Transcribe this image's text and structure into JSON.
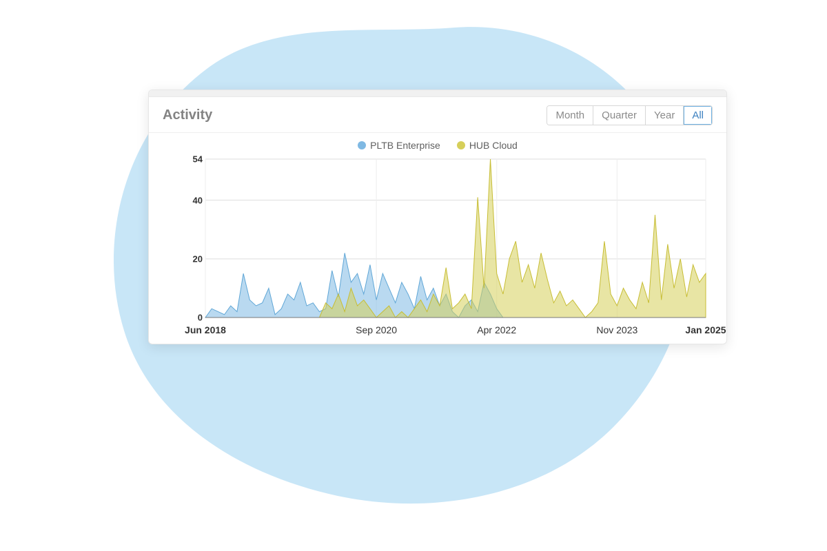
{
  "card": {
    "title": "Activity",
    "ranges": [
      "Month",
      "Quarter",
      "Year",
      "All"
    ],
    "active_range": "All"
  },
  "legend": {
    "series_a": {
      "label": "PLTB Enterprise",
      "color": "#7fb9e3"
    },
    "series_b": {
      "label": "HUB Cloud",
      "color": "#d6cf5a"
    }
  },
  "chart_data": {
    "type": "area",
    "title": "Activity",
    "xlabel": "",
    "ylabel": "",
    "ylim": [
      0,
      54
    ],
    "y_ticks": [
      0,
      20,
      40,
      54
    ],
    "x_ticks": [
      {
        "label": "Jun 2018",
        "pos": 0,
        "bold": true
      },
      {
        "label": "Sep 2020",
        "pos": 27,
        "bold": false
      },
      {
        "label": "Apr 2022",
        "pos": 46,
        "bold": false
      },
      {
        "label": "Nov 2023",
        "pos": 65,
        "bold": false
      },
      {
        "label": "Jan 2025",
        "pos": 79,
        "bold": true
      }
    ],
    "x_range": [
      0,
      79
    ],
    "series": [
      {
        "name": "PLTB Enterprise",
        "color_fill": "rgba(127,185,227,0.55)",
        "color_stroke": "#5fa6d6",
        "values": [
          0,
          3,
          2,
          1,
          4,
          2,
          15,
          6,
          4,
          5,
          10,
          1,
          3,
          8,
          6,
          12,
          4,
          5,
          2,
          3,
          16,
          7,
          22,
          12,
          15,
          8,
          18,
          6,
          15,
          10,
          5,
          12,
          8,
          3,
          14,
          6,
          10,
          4,
          8,
          2,
          0,
          4,
          6,
          2,
          12,
          8,
          3,
          0,
          0,
          0,
          0,
          0,
          0,
          0,
          0,
          0,
          0,
          0,
          0,
          0,
          0,
          0,
          0,
          0,
          0,
          0,
          0,
          0,
          0,
          0,
          0,
          0,
          0,
          0,
          0,
          0,
          0,
          0,
          0,
          0
        ]
      },
      {
        "name": "HUB Cloud",
        "color_fill": "rgba(214,207,90,0.55)",
        "color_stroke": "#c7bd34",
        "values": [
          0,
          0,
          0,
          0,
          0,
          0,
          0,
          0,
          0,
          0,
          0,
          0,
          0,
          0,
          0,
          0,
          0,
          0,
          0,
          5,
          3,
          8,
          2,
          10,
          4,
          6,
          3,
          0,
          2,
          4,
          0,
          2,
          0,
          3,
          6,
          2,
          8,
          4,
          17,
          3,
          5,
          8,
          3,
          41,
          10,
          54,
          15,
          8,
          20,
          26,
          12,
          18,
          10,
          22,
          13,
          5,
          9,
          4,
          6,
          3,
          0,
          2,
          5,
          26,
          8,
          4,
          10,
          6,
          3,
          12,
          5,
          35,
          6,
          25,
          10,
          20,
          7,
          18,
          12,
          15
        ]
      }
    ]
  }
}
